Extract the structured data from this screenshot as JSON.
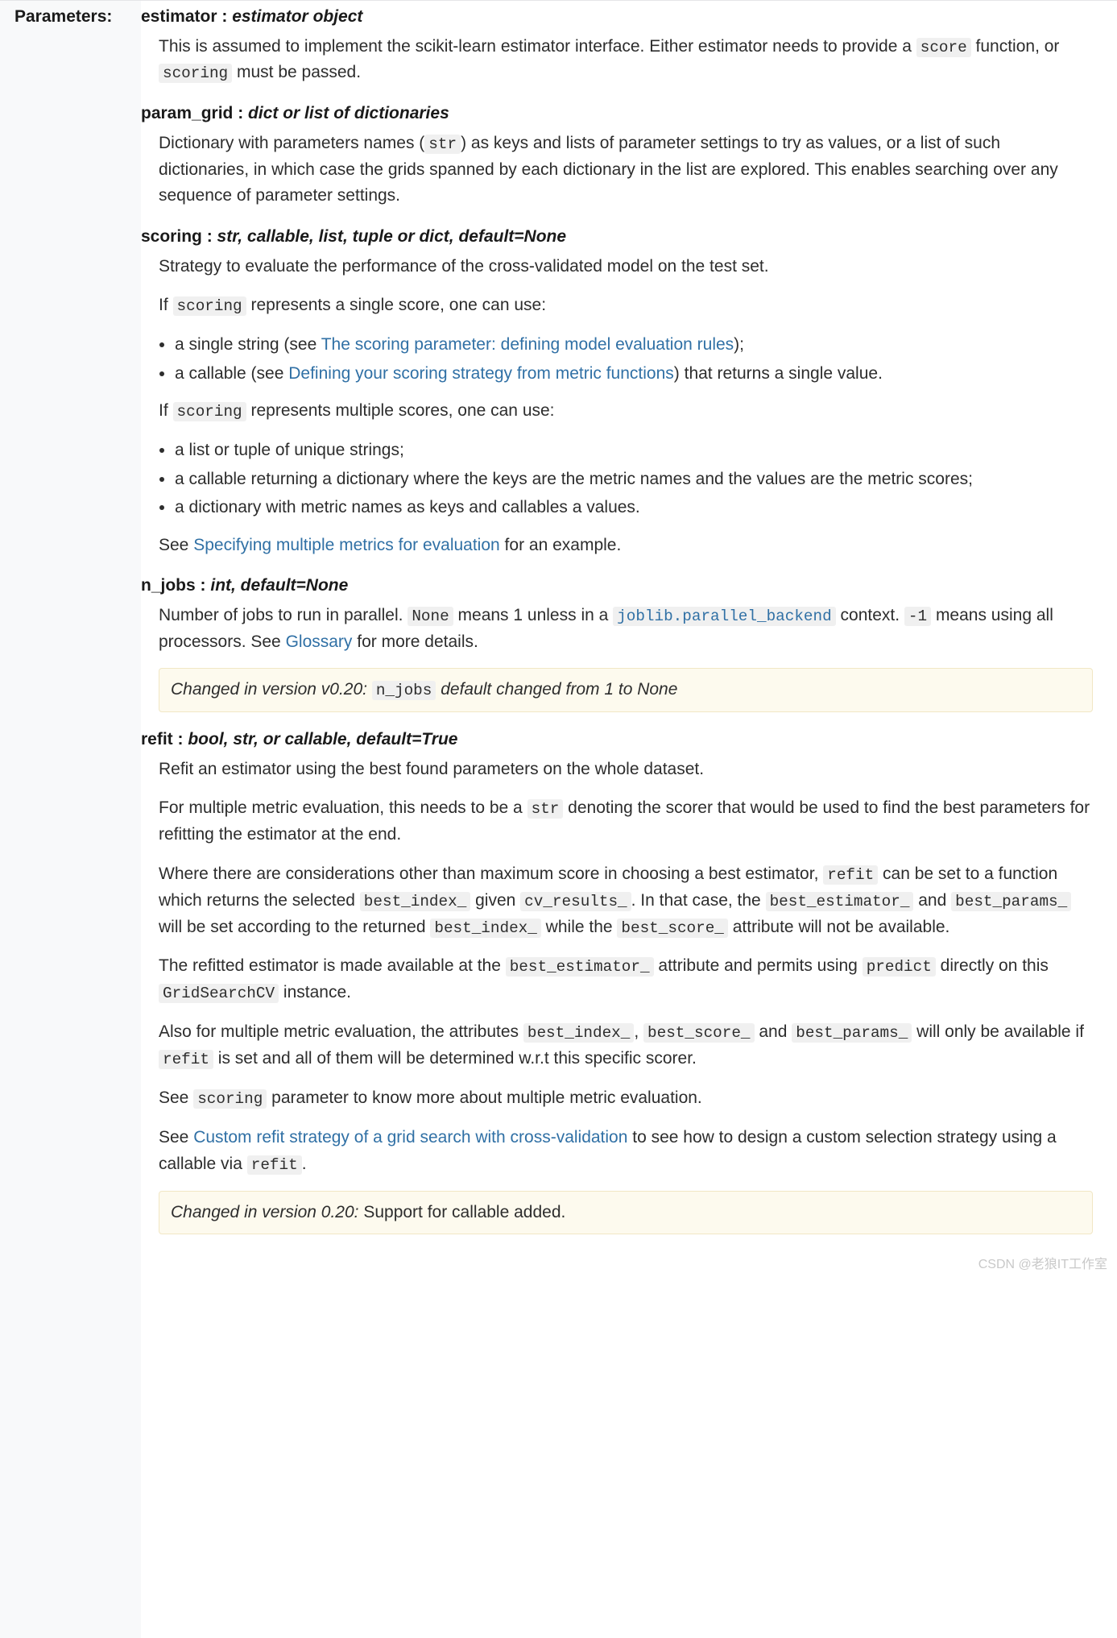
{
  "label": "Parameters:",
  "watermark": "CSDN @老狼IT工作室",
  "p": {
    "estimator": {
      "name": "estimator",
      "type": "estimator object",
      "d1a": "This is assumed to implement the scikit-learn estimator interface. Either estimator needs to provide a ",
      "d1c": "score",
      "d1b": " function, or ",
      "d1d": "scoring",
      "d1e": " must be passed."
    },
    "param_grid": {
      "name": "param_grid",
      "type": "dict or list of dictionaries",
      "d1a": "Dictionary with parameters names (",
      "d1c": "str",
      "d1b": ") as keys and lists of parameter settings to try as values, or a list of such dictionaries, in which case the grids spanned by each dictionary in the list are explored. This enables searching over any sequence of parameter settings."
    },
    "scoring": {
      "name": "scoring",
      "type": "str, callable, list, tuple or dict, default=None",
      "d1": "Strategy to evaluate the performance of the cross-validated model on the test set.",
      "d2a": "If ",
      "d2c": "scoring",
      "d2b": " represents a single score, one can use:",
      "li1a": "a single string (see ",
      "li1link": "The scoring parameter: defining model evaluation rules",
      "li1b": ");",
      "li2a": "a callable (see ",
      "li2link": "Defining your scoring strategy from metric functions",
      "li2b": ") that returns a single value.",
      "d3a": "If ",
      "d3c": "scoring",
      "d3b": " represents multiple scores, one can use:",
      "li3": "a list or tuple of unique strings;",
      "li4": "a callable returning a dictionary where the keys are the metric names and the values are the metric scores;",
      "li5": "a dictionary with metric names as keys and callables a values.",
      "d4a": "See ",
      "d4link": "Specifying multiple metrics for evaluation",
      "d4b": " for an example."
    },
    "n_jobs": {
      "name": "n_jobs",
      "type": "int, default=None",
      "d1a": "Number of jobs to run in parallel. ",
      "d1c1": "None",
      "d1b": " means 1 unless in a ",
      "d1c2": "joblib.parallel_backend",
      "d1c": " context. ",
      "d1c3": "-1",
      "d1d": " means using all processors. See ",
      "d1link": "Glossary",
      "d1e": " for more details.",
      "note_a": "Changed in version v0.20: ",
      "note_c": "n_jobs",
      "note_b": " default changed from 1 to None"
    },
    "refit": {
      "name": "refit",
      "type": "bool, str, or callable, default=True",
      "d1": "Refit an estimator using the best found parameters on the whole dataset.",
      "d2a": "For multiple metric evaluation, this needs to be a ",
      "d2c": "str",
      "d2b": " denoting the scorer that would be used to find the best parameters for refitting the estimator at the end.",
      "d3a": "Where there are considerations other than maximum score in choosing a best estimator, ",
      "d3c1": "refit",
      "d3b": " can be set to a function which returns the selected ",
      "d3c2": "best_index_",
      "d3c": " given ",
      "d3c3": "cv_results_",
      "d3d": ". In that case, the ",
      "d3c4": "best_estimator_",
      "d3e": " and ",
      "d3c5": "best_params_",
      "d3f": " will be set according to the returned ",
      "d3c6": "best_index_",
      "d3g": " while the ",
      "d3c7": "best_score_",
      "d3h": " attribute will not be available.",
      "d4a": "The refitted estimator is made available at the ",
      "d4c1": "best_estimator_",
      "d4b": " attribute and permits using ",
      "d4c2": "predict",
      "d4c": " directly on this ",
      "d4c3": "GridSearchCV",
      "d4d": " instance.",
      "d5a": "Also for multiple metric evaluation, the attributes ",
      "d5c1": "best_index_",
      "d5b": ", ",
      "d5c2": "best_score_",
      "d5c": " and ",
      "d5c3": "best_params_",
      "d5d": " will only be available if ",
      "d5c4": "refit",
      "d5e": " is set and all of them will be determined w.r.t this specific scorer.",
      "d6a": "See ",
      "d6c": "scoring",
      "d6b": " parameter to know more about multiple metric evaluation.",
      "d7a": "See ",
      "d7link": "Custom refit strategy of a grid search with cross-validation",
      "d7b": " to see how to design a custom selection strategy using a callable via ",
      "d7c": "refit",
      "d7d": ".",
      "note_a": "Changed in version 0.20:",
      "note_b": " Support for callable added."
    }
  }
}
